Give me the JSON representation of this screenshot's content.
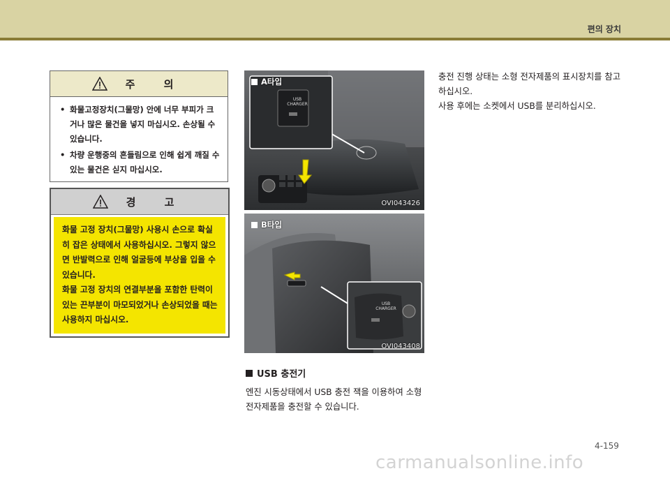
{
  "header": {
    "title": "편의 장치"
  },
  "caution": {
    "title": "주 의",
    "items": [
      "화물고정장치(그물망) 안에 너무 부피가 크거나 많은 물건을 넣지 마십시오. 손상될 수 있습니다.",
      "차량 운행중의 흔들림으로 인해 쉽게 깨질 수 있는 물건은 싣지 마십시오."
    ]
  },
  "warning": {
    "title": "경 고",
    "paragraphs": [
      "화물 고정 장치(그물망) 사용시 손으로 확실히 잡은 상태에서 사용하십시오. 그렇지 않으면 반발력으로 인해 얼굴등에 부상을 입을 수 있습니다.",
      "화물 고정 장치의 연결부분을 포함한 탄력이 있는 끈부분이 마모되었거나 손상되었을 때는 사용하지 마십시오."
    ]
  },
  "photo_a": {
    "label": "A타입",
    "code": "OVI043426",
    "usb_text": "USB",
    "charger_text": "CHARGER"
  },
  "photo_b": {
    "label": "B타입",
    "code": "OVI043408",
    "usb_text": "USB",
    "charger_text": "CHARGER"
  },
  "usb_section": {
    "heading": "USB 충전기",
    "description": "엔진 시동상태에서 USB 충전 잭을 이용하여 소형 전자제품을 충전할 수 있습니다."
  },
  "right_column": {
    "lines": [
      "충전 진행 상태는 소형 전자제품의 표시장치를 참고하십시오.",
      "사용 후에는 소켓에서 USB를 분리하십시오."
    ]
  },
  "page_number": "4-159",
  "watermark": "carmanualsonline.info"
}
